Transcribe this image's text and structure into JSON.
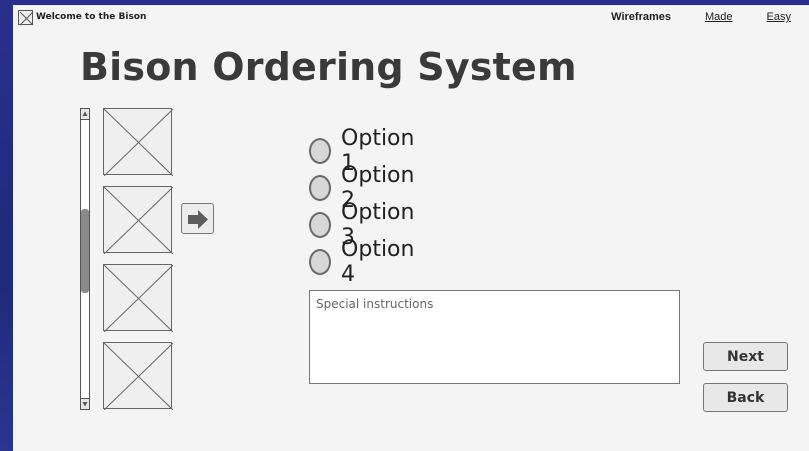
{
  "header": {
    "app_title": "Welcome to the Bison",
    "nav": {
      "brand": "Wireframes",
      "links": [
        "Made",
        "Easy"
      ]
    }
  },
  "main": {
    "page_title": "Bison Ordering System",
    "options": [
      "Option 1",
      "Option 2",
      "Option 3",
      "Option 4"
    ],
    "special_instructions_placeholder": "Special instructions",
    "buttons": {
      "next": "Next",
      "back": "Back"
    }
  }
}
